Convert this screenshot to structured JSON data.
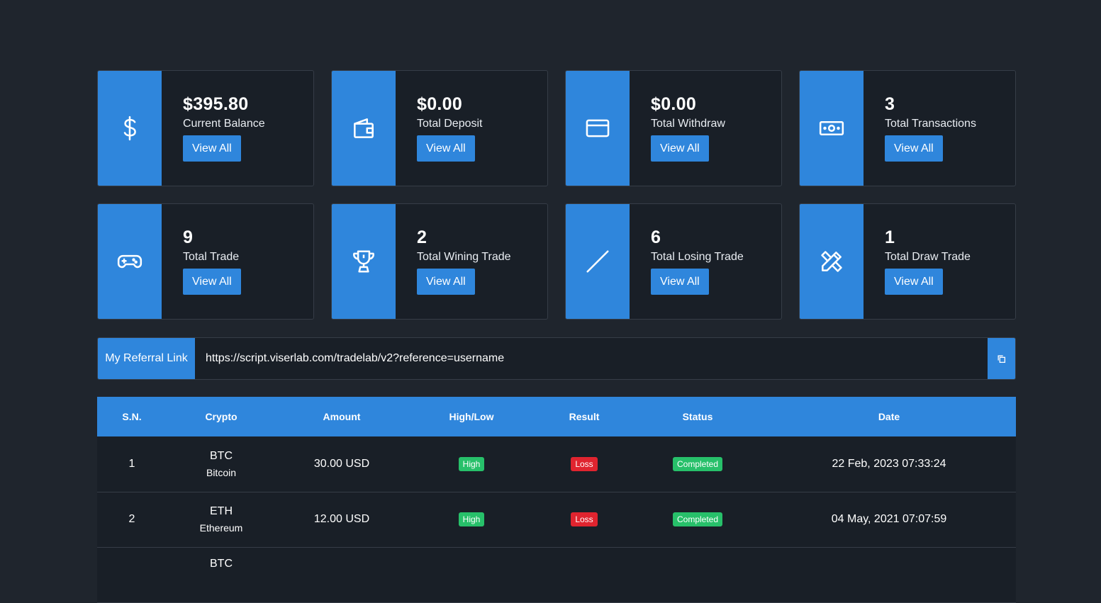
{
  "cards": [
    {
      "icon": "dollar-icon",
      "value": "$395.80",
      "label": "Current Balance",
      "button": "View All"
    },
    {
      "icon": "wallet-icon",
      "value": "$0.00",
      "label": "Total Deposit",
      "button": "View All"
    },
    {
      "icon": "credit-card-icon",
      "value": "$0.00",
      "label": "Total Withdraw",
      "button": "View All"
    },
    {
      "icon": "money-bill-icon",
      "value": "3",
      "label": "Total Transactions",
      "button": "View All"
    },
    {
      "icon": "gamepad-icon",
      "value": "9",
      "label": "Total Trade",
      "button": "View All"
    },
    {
      "icon": "trophy-icon",
      "value": "2",
      "label": "Total Wining Trade",
      "button": "View All"
    },
    {
      "icon": "slash-icon",
      "value": "6",
      "label": "Total Losing Trade",
      "button": "View All"
    },
    {
      "icon": "pencil-ruler-icon",
      "value": "1",
      "label": "Total Draw Trade",
      "button": "View All"
    }
  ],
  "referral": {
    "label": "My Referral Link",
    "value": "https://script.viserlab.com/tradelab/v2?reference=username",
    "copy_icon": "copy-icon"
  },
  "table": {
    "headers": [
      "S.N.",
      "Crypto",
      "Amount",
      "High/Low",
      "Result",
      "Status",
      "Date"
    ],
    "rows": [
      {
        "sn": "1",
        "symbol": "BTC",
        "name": "Bitcoin",
        "amount": "30.00 USD",
        "highlow": "High",
        "result": "Loss",
        "status": "Completed",
        "date": "22 Feb, 2023 07:33:24"
      },
      {
        "sn": "2",
        "symbol": "ETH",
        "name": "Ethereum",
        "amount": "12.00 USD",
        "highlow": "High",
        "result": "Loss",
        "status": "Completed",
        "date": "04 May, 2021 07:07:59"
      },
      {
        "sn": "",
        "symbol": "BTC",
        "name": "",
        "amount": "",
        "highlow": "",
        "result": "",
        "status": "",
        "date": ""
      }
    ]
  },
  "colors": {
    "accent": "#2f86dc",
    "success": "#27c06a",
    "danger": "#e0242f",
    "card_bg": "#191f27",
    "page_bg": "#1f252d"
  }
}
